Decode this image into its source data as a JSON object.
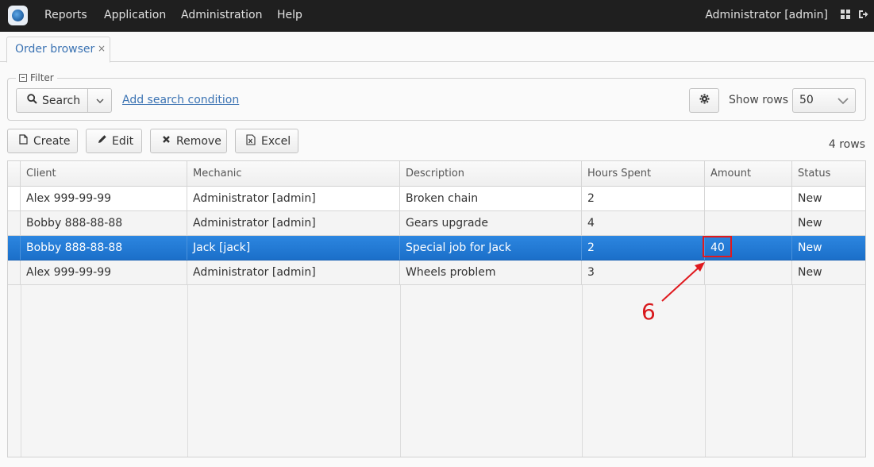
{
  "menubar": {
    "items": [
      {
        "label": "Reports"
      },
      {
        "label": "Application"
      },
      {
        "label": "Administration"
      },
      {
        "label": "Help"
      }
    ],
    "user": "Administrator [admin]"
  },
  "tabs": [
    {
      "label": "Order browser",
      "close": "×"
    }
  ],
  "filter": {
    "legend": "Filter",
    "search_label": "Search",
    "add_condition": "Add search condition",
    "show_rows_label": "Show rows",
    "show_rows_value": "50"
  },
  "actions": {
    "create": "Create",
    "edit": "Edit",
    "remove": "Remove",
    "excel": "Excel"
  },
  "row_count": "4 rows",
  "grid": {
    "columns": [
      "Client",
      "Mechanic",
      "Description",
      "Hours Spent",
      "Amount",
      "Status"
    ],
    "rows": [
      [
        "Alex 999-99-99",
        "Administrator [admin]",
        "Broken chain",
        "2",
        "",
        "New"
      ],
      [
        "Bobby 888-88-88",
        "Administrator [admin]",
        "Gears upgrade",
        "4",
        "",
        "New"
      ],
      [
        "Bobby 888-88-88",
        "Jack [jack]",
        "Special job for Jack",
        "2",
        "40",
        "New"
      ],
      [
        "Alex 999-99-99",
        "Administrator [admin]",
        "Wheels problem",
        "3",
        "",
        "New"
      ]
    ],
    "selected_row_index": 2
  },
  "annotation": {
    "number": "6",
    "color": "#e0191e"
  },
  "colors": {
    "menubar": "#1f1f1f",
    "link": "#3b73b3",
    "selection": "#1b6fc9"
  }
}
